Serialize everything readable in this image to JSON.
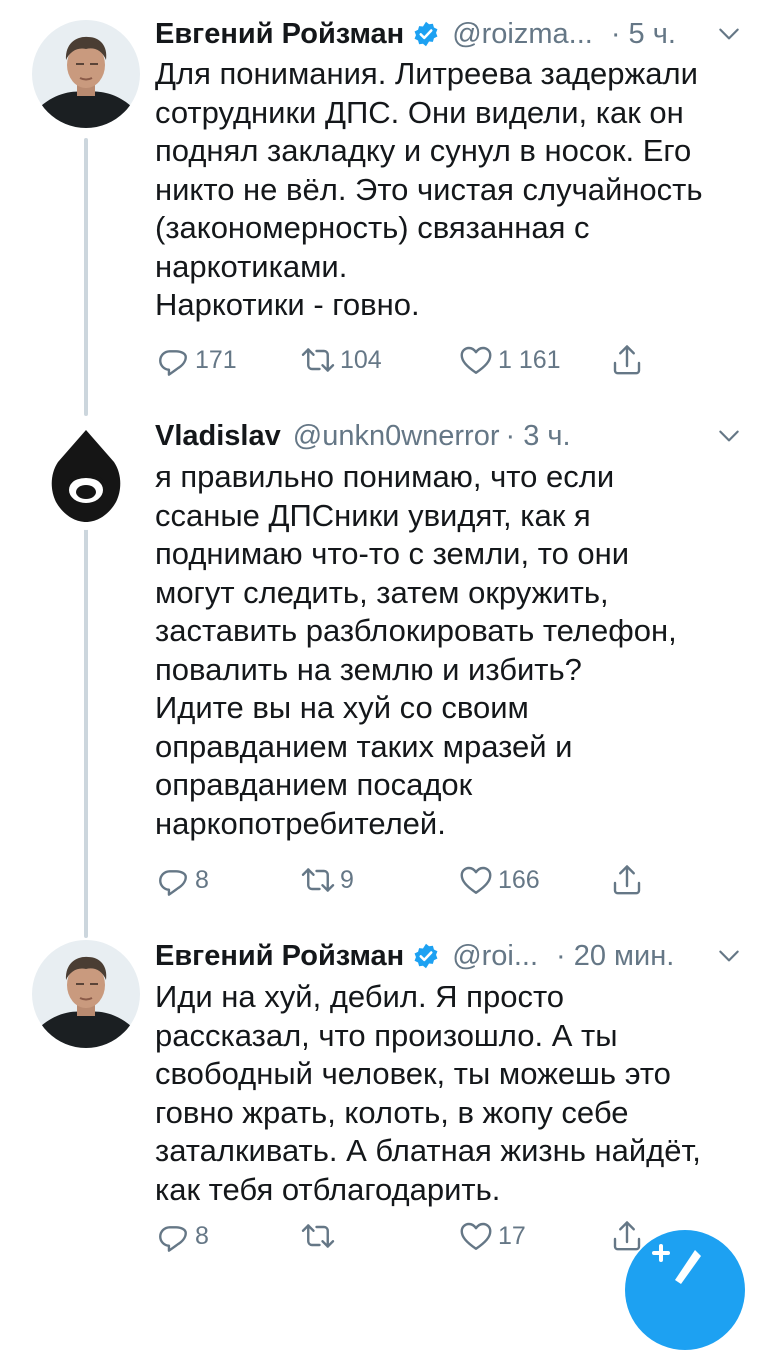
{
  "tweets": [
    {
      "name": "Евгений Ройзман",
      "handle": "@roizma...",
      "time": "· 5 ч.",
      "lines": [
        "Для понимания. Литреева задержали",
        "сотрудники ДПС. Они видели, как он",
        "поднял закладку и сунул в носок. Его",
        "никто не вёл. Это чистая случайность",
        "(закономерность) связанная с",
        "наркотиками.",
        "Наркотики - говно."
      ],
      "replies": "171",
      "retweets": "104",
      "likes": "1 161"
    },
    {
      "name": "Vladislav",
      "handle": "@unkn0wnerror",
      "time": "· 3 ч.",
      "lines": [
        "я правильно понимаю, что если",
        "ссаные ДПСники увидят, как я",
        "поднимаю что-то с земли, то они",
        "могут следить, затем окружить,",
        "заставить разблокировать телефон,",
        "повалить на землю и избить?",
        "Идите вы на хуй со своим",
        "оправданием таких мразей и",
        "оправданием посадок",
        "наркопотребителей."
      ],
      "replies": "8",
      "retweets": "9",
      "likes": "166"
    },
    {
      "name": "Евгений Ройзман",
      "handle": "@roi...",
      "time": "· 20 мин.",
      "lines": [
        "Иди на хуй, дебил. Я просто",
        "рассказал, что произошло. А ты",
        "свободный человек, ты можешь это",
        "говно жрать, колоть, в жопу себе",
        "заталкивать. А блатная жизнь найдёт,",
        "как тебя отблагодарить."
      ],
      "replies": "8",
      "retweets": "",
      "likes": "17"
    }
  ],
  "colors": {
    "accent": "#1da1f2",
    "muted": "#657786",
    "text": "#14171a",
    "thread_line": "#ccd6dd"
  },
  "icons": [
    "reply-icon",
    "retweet-icon",
    "like-icon",
    "share-icon",
    "chevron-down-icon",
    "verified-icon",
    "compose-icon"
  ]
}
